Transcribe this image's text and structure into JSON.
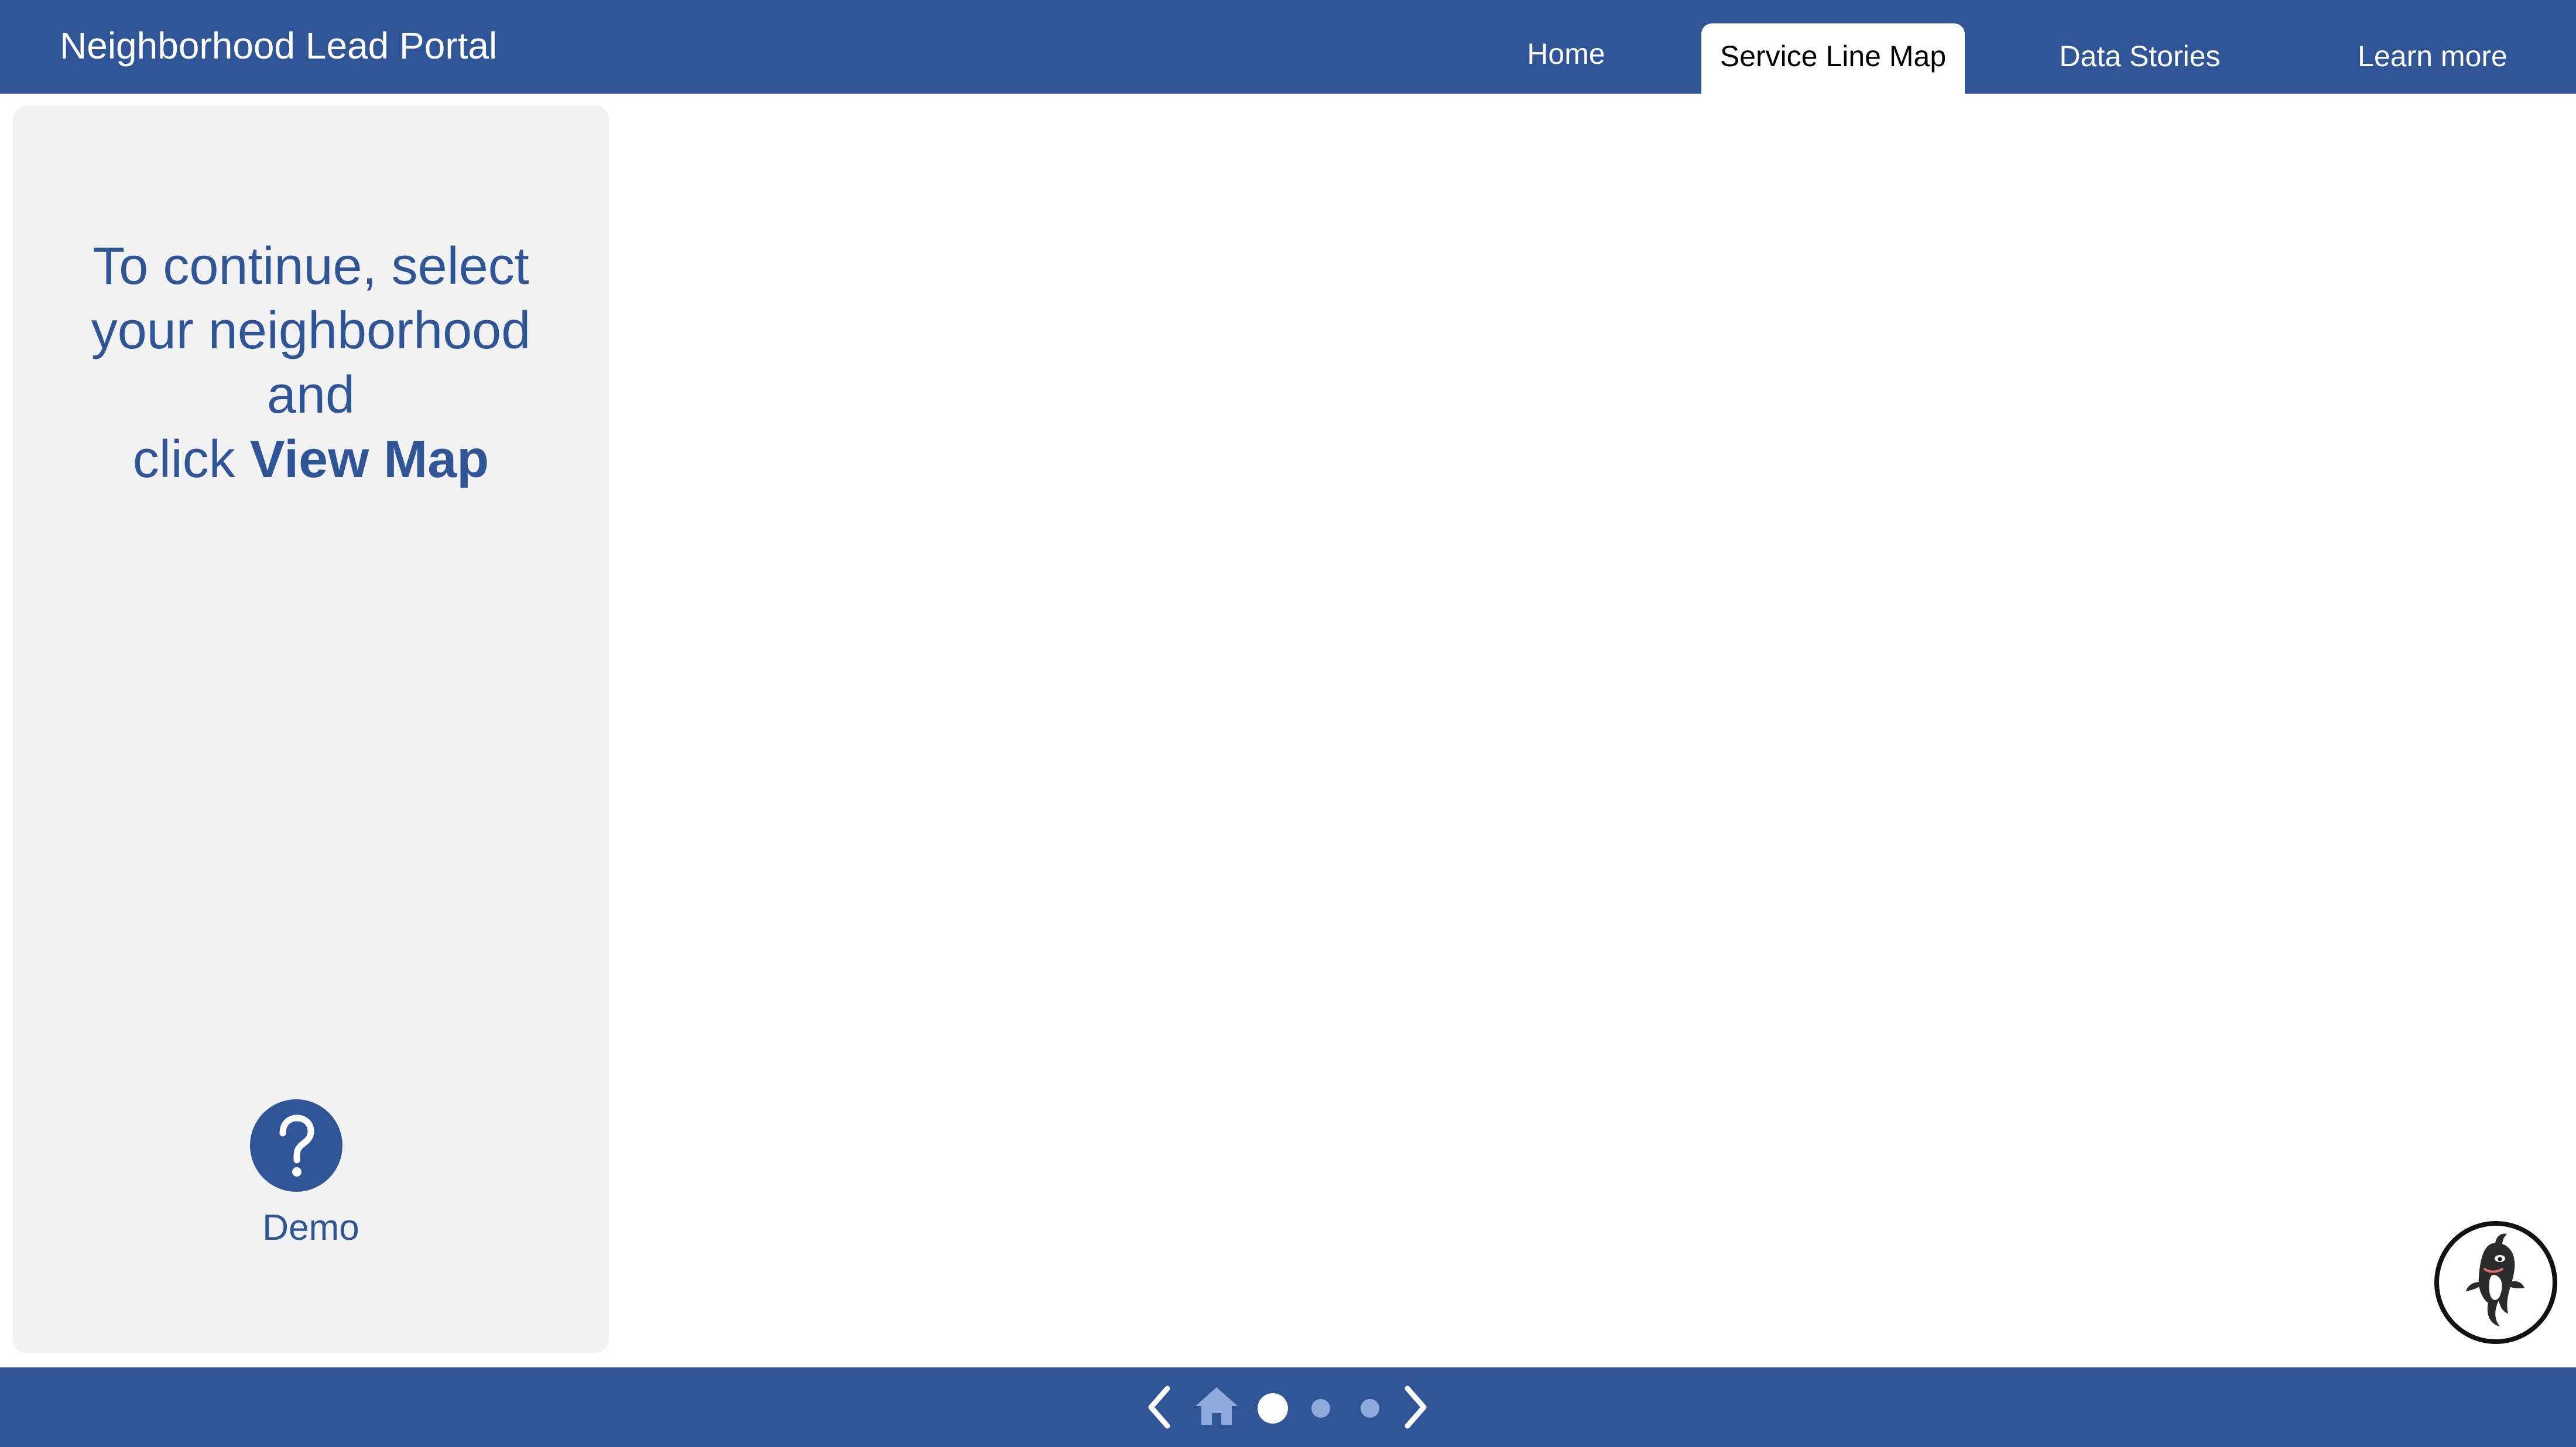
{
  "header": {
    "app_title": "Neighborhood Lead Portal",
    "tabs": [
      {
        "label": "Home",
        "active": false
      },
      {
        "label": "Service Line Map",
        "active": true
      },
      {
        "label": "Data Stories",
        "active": false
      },
      {
        "label": "Learn more",
        "active": false
      }
    ]
  },
  "sidebar": {
    "instruction": {
      "line1": "To continue, select",
      "line2": "your neighborhood",
      "line3": "and",
      "line4_prefix": "click ",
      "line4_bold": "View Map"
    },
    "help_icon": "question-mark-icon",
    "demo_label": "Demo"
  },
  "assistant": {
    "icon": "orca-mascot-icon"
  },
  "footer_nav": {
    "prev_icon": "chevron-left-icon",
    "home_icon": "home-icon",
    "next_icon": "chevron-right-icon",
    "pages": 3,
    "current_page": 1
  },
  "colors": {
    "brand": "#2f5597",
    "sidebar_bg": "#f2f2f2",
    "dot_inactive": "#8faadc"
  }
}
